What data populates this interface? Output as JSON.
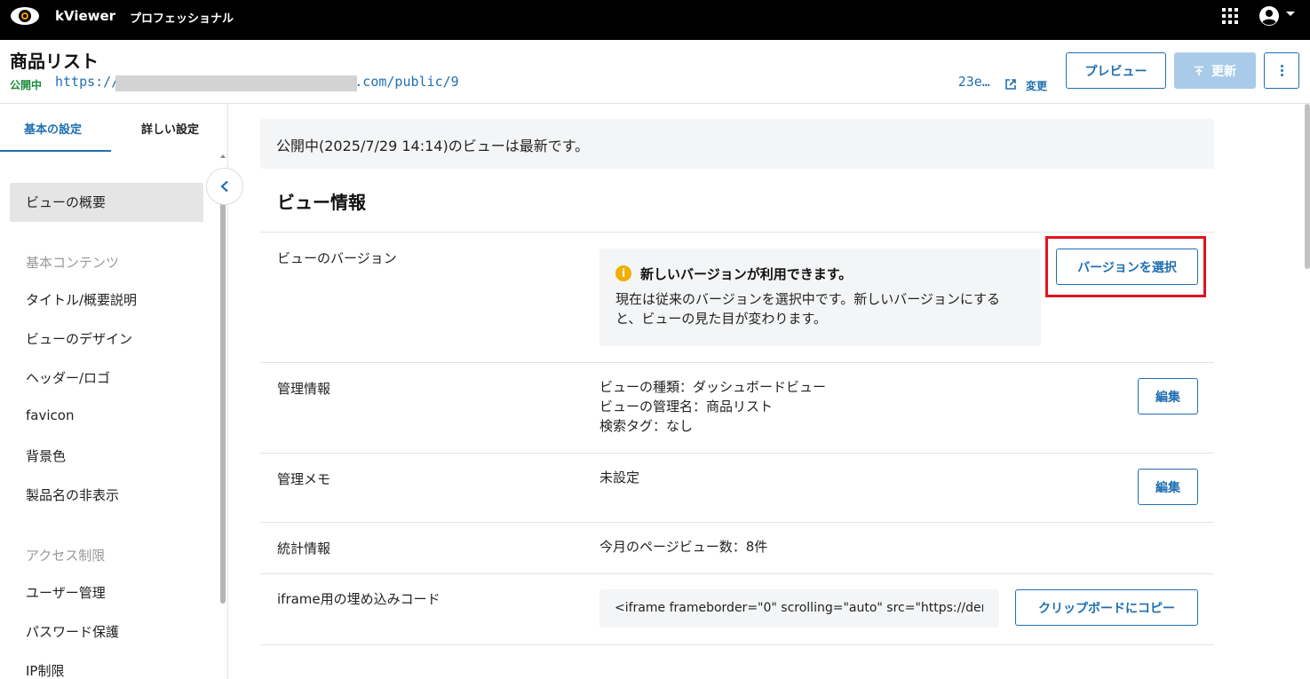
{
  "app": {
    "brand": "kViewer",
    "edition": "プロフェッショナル"
  },
  "header": {
    "title": "商品リスト",
    "status": "公開中",
    "url_prefix": "https://",
    "url_mid": "g.com/public/9",
    "url_tail": "23e…",
    "change_label": "変更",
    "preview_label": "プレビュー",
    "update_label": "更新"
  },
  "sidebar": {
    "tabs": [
      {
        "label": "基本の設定",
        "active": true
      },
      {
        "label": "詳しい設定",
        "active": false
      }
    ],
    "selected": "ビューの概要",
    "section_basic": "基本コンテンツ",
    "basic_items": [
      "タイトル/概要説明",
      "ビューのデザイン",
      "ヘッダー/ロゴ",
      "favicon",
      "背景色",
      "製品名の非表示"
    ],
    "section_access": "アクセス制限",
    "access_items": [
      "ユーザー管理",
      "パスワード保護",
      "IP制限"
    ]
  },
  "main": {
    "notice": "公開中(2025/7/29 14:14)のビューは最新です。",
    "section_title": "ビュー情報",
    "version": {
      "label": "ビューのバージョン",
      "title": "新しいバージョンが利用できます。",
      "description": "現在は従来のバージョンを選択中です。新しいバージョンにすると、ビューの見た目が変わります。",
      "button": "バージョンを選択"
    },
    "management": {
      "label": "管理情報",
      "lines": [
        "ビューの種類：ダッシュボードビュー",
        "ビューの管理名：商品リスト",
        "検索タグ：なし"
      ],
      "button": "編集"
    },
    "memo": {
      "label": "管理メモ",
      "value": "未設定",
      "button": "編集"
    },
    "stats": {
      "label": "統計情報",
      "value": "今月のページビュー数：8件"
    },
    "embed": {
      "label": "iframe用の埋め込みコード",
      "code": "<iframe frameborder=\"0\" scrolling=\"auto\" src=\"https://den",
      "button": "クリップボードにコピー"
    }
  },
  "colors": {
    "accent": "#1f6fb2",
    "status_green": "#1a8a3a",
    "highlight_red": "#e0141e",
    "warning": "#f0b000"
  }
}
